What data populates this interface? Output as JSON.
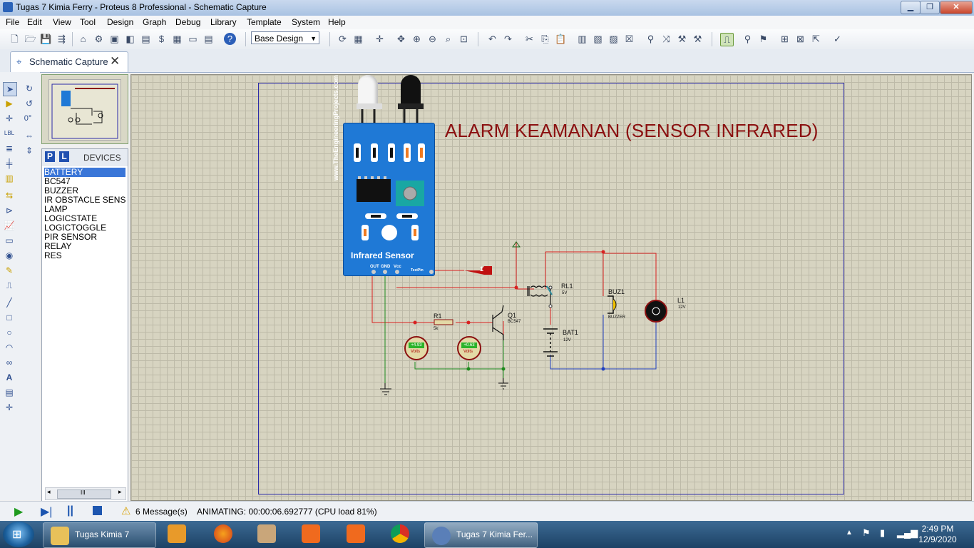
{
  "window": {
    "title": "Tugas 7 Kimia Ferry - Proteus 8 Professional - Schematic Capture",
    "min": "▁",
    "max": "❐",
    "close": "✕"
  },
  "menu": [
    "File",
    "Edit",
    "View",
    "Tool",
    "Design",
    "Graph",
    "Debug",
    "Library",
    "Template",
    "System",
    "Help"
  ],
  "toolbar": {
    "design_select": "Base Design"
  },
  "tab": {
    "label": "Schematic Capture",
    "close": "✕"
  },
  "rotation": "0°",
  "devices": {
    "p_button": "P",
    "l_button": "L",
    "title": "DEVICES",
    "items": [
      "BATTERY",
      "BC547",
      "BUZZER",
      "IR OBSTACLE SENSOR",
      "LAMP",
      "LOGICSTATE",
      "LOGICTOGGLE",
      "PIR SENSOR",
      "RELAY",
      "RES"
    ],
    "selected": "BATTERY",
    "scroll_thumb": "III"
  },
  "schematic": {
    "title": "ALARM KEAMANAN (SENSOR INFRARED)",
    "sensor": {
      "url": "www.TheEngineeringProjects.com",
      "name": "Infrared Sensor",
      "pin_out": "OUT",
      "pin_gnd": "GND",
      "pin_vcc": "Vcc",
      "test_pin": "TestPin"
    },
    "probe": "1",
    "relay": {
      "ref": "RL1",
      "value": "5V"
    },
    "buzzer": {
      "ref": "BUZ1",
      "value": "BUZZER"
    },
    "lamp": {
      "ref": "L1",
      "value": "12V"
    },
    "battery": {
      "ref": "BAT1",
      "value": "12V"
    },
    "resistor": {
      "ref": "R1",
      "value": "5k"
    },
    "transistor": {
      "ref": "Q1",
      "value": "BC547"
    },
    "meter1": {
      "reading": "+4.93",
      "unit": "Volts"
    },
    "meter2": {
      "reading": "+0.63",
      "unit": "Volts"
    }
  },
  "status": {
    "messages": "6 Message(s)",
    "animating": "ANIMATING: 00:00:06.692777 (CPU load 81%)"
  },
  "taskbar": {
    "explorer": "Tugas Kimia 7",
    "proteus": "Tugas 7 Kimia Fer...",
    "time": "2:49 PM",
    "date": "12/9/2020"
  },
  "colors": {
    "wire_red": "#d82020",
    "wire_blue": "#2040c0",
    "wire_green": "#1e8a1e",
    "sheet_border": "#2b2ba8",
    "title_red": "#8b1010",
    "canvas": "#d7d4c1"
  }
}
